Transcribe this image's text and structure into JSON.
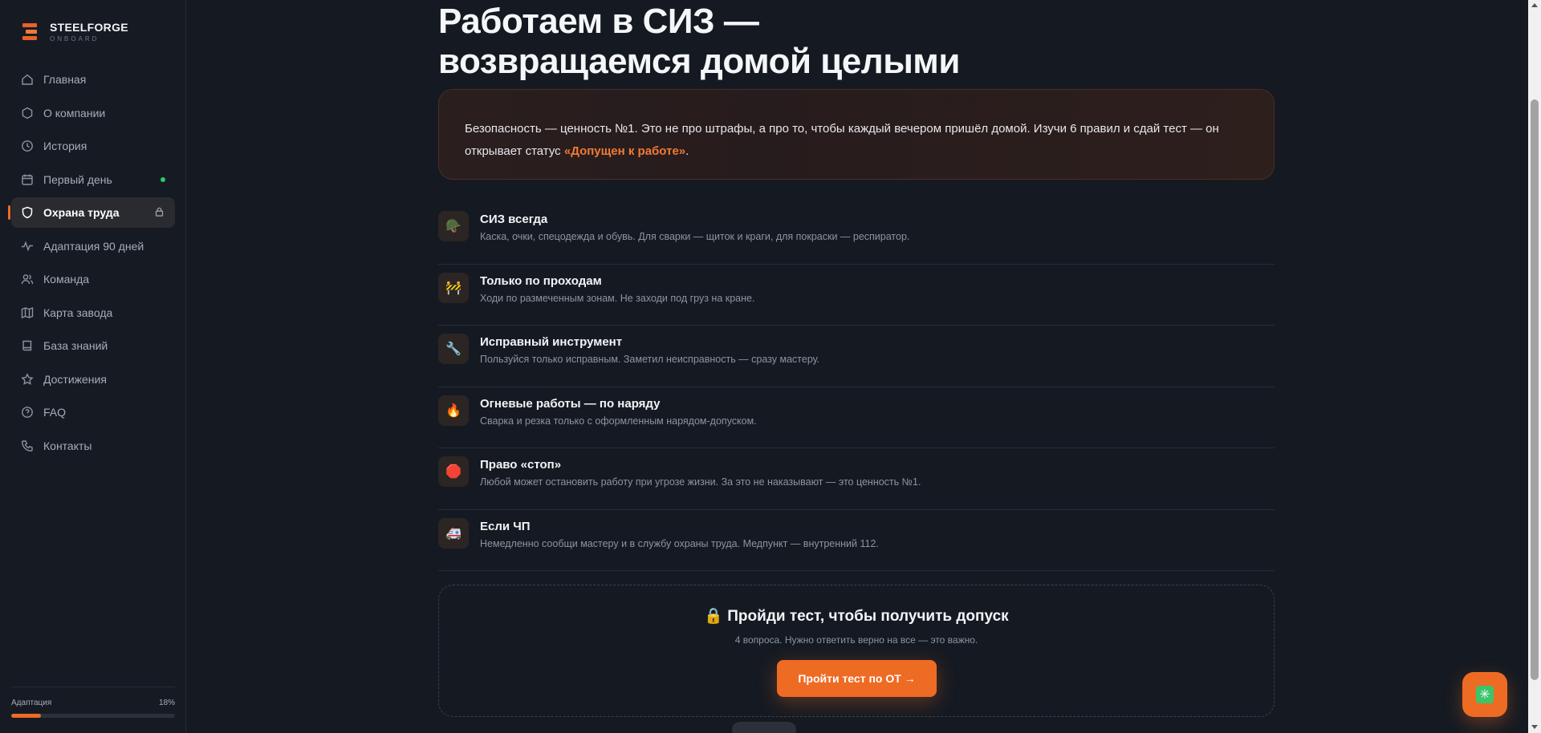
{
  "brand": {
    "name": "STEELFORGE",
    "sub": "ONBOARD"
  },
  "sidebar": {
    "items": [
      {
        "label": "Главная",
        "icon": "home-icon"
      },
      {
        "label": "О компании",
        "icon": "hexagon-icon"
      },
      {
        "label": "История",
        "icon": "clock-icon"
      },
      {
        "label": "Первый день",
        "icon": "calendar-icon",
        "status": "new-dot"
      },
      {
        "label": "Охрана труда",
        "icon": "shield-icon",
        "active": true,
        "locked": true
      },
      {
        "label": "Адаптация 90 дней",
        "icon": "pulse-icon"
      },
      {
        "label": "Команда",
        "icon": "users-icon"
      },
      {
        "label": "Карта завода",
        "icon": "map-icon"
      },
      {
        "label": "База знаний",
        "icon": "book-icon"
      },
      {
        "label": "Достижения",
        "icon": "star-icon"
      },
      {
        "label": "FAQ",
        "icon": "help-icon"
      },
      {
        "label": "Контакты",
        "icon": "phone-icon"
      }
    ],
    "progress": {
      "label": "Адаптация",
      "percent_text": "18%",
      "percent": 18
    }
  },
  "main": {
    "title_line1": "Работаем в СИЗ —",
    "title_line2": "возвращаемся домой целыми",
    "intro": {
      "text": "Безопасность — ценность №1. Это не про штрафы, а про то, чтобы каждый вечером пришёл домой. Изучи 6 правил и сдай тест — он открывает статус ",
      "highlight": "«Допущен к работе»",
      "end": "."
    },
    "rules": [
      {
        "icon": "helmet-icon",
        "emoji": "🪖",
        "title": "СИЗ всегда",
        "desc": "Каска, очки, спецодежда и обувь. Для сварки — щиток и краги, для покраски — респиратор."
      },
      {
        "icon": "barrier-icon",
        "emoji": "🚧",
        "title": "Только по проходам",
        "desc": "Ходи по размеченным зонам. Не заходи под груз на кране."
      },
      {
        "icon": "wrench-icon",
        "emoji": "🔧",
        "title": "Исправный инструмент",
        "desc": "Пользуйся только исправным. Заметил неисправность — сразу мастеру."
      },
      {
        "icon": "fire-icon",
        "emoji": "🔥",
        "title": "Огневые работы — по наряду",
        "desc": "Сварка и резка только с оформленным нарядом-допуском."
      },
      {
        "icon": "stop-icon",
        "emoji": "🛑",
        "title": "Право «стоп»",
        "desc": "Любой может остановить работу при угрозе жизни. За это не наказывают — это ценность №1."
      },
      {
        "icon": "ambulance-icon",
        "emoji": "🚑",
        "title": "Если ЧП",
        "desc": "Немедленно сообщи мастеру и в службу охраны труда. Медпункт — внутренний 112."
      }
    ],
    "test": {
      "title": "🔒 Пройди тест, чтобы получить допуск",
      "sub": "4 вопроса. Нужно ответить верно на все — это важно.",
      "button": "Пройти тест по ОТ →"
    }
  },
  "fab": {
    "icon": "sparkle-icon",
    "glyph": "✳"
  },
  "colors": {
    "accent": "#ee6b24",
    "bg": "#151a22",
    "success": "#2fc76a"
  }
}
